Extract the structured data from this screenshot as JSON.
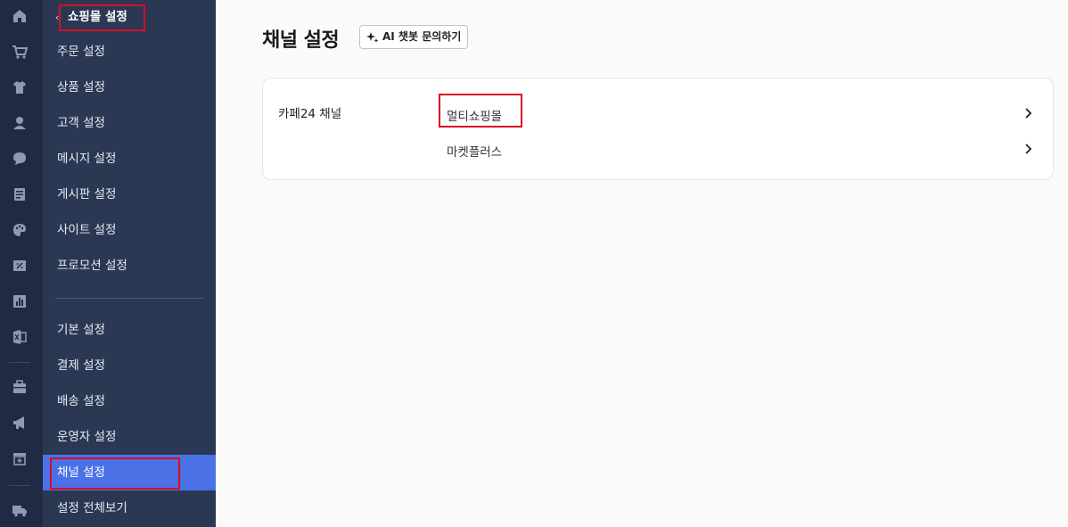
{
  "rail": {
    "icons": [
      "home-icon",
      "cart-icon",
      "tshirt-icon",
      "user-icon",
      "chat-icon",
      "board-icon",
      "palette-icon",
      "discount-icon",
      "chart-icon",
      "excel-icon",
      "briefcase-icon",
      "megaphone-icon",
      "store-icon",
      "truck-icon"
    ]
  },
  "sidebar": {
    "back_label": "쇼핑몰 설정",
    "group1": [
      "주문 설정",
      "상품 설정",
      "고객 설정",
      "메시지 설정",
      "게시판 설정",
      "사이트 설정",
      "프로모션 설정"
    ],
    "group2": [
      "기본 설정",
      "결제 설정",
      "배송 설정",
      "운영자 설정",
      "채널 설정",
      "설정 전체보기"
    ],
    "active": "채널 설정"
  },
  "main": {
    "title": "채널 설정",
    "ai_button_label": "AI 챗봇 문의하기",
    "card": {
      "label": "카페24 채널",
      "rows": [
        "멀티쇼핑몰",
        "마켓플러스"
      ]
    }
  },
  "colors": {
    "rail_bg": "#1f2a44",
    "sidebar_bg": "#2b3854",
    "active_bg": "#4a72e6",
    "highlight": "#d40f22"
  }
}
